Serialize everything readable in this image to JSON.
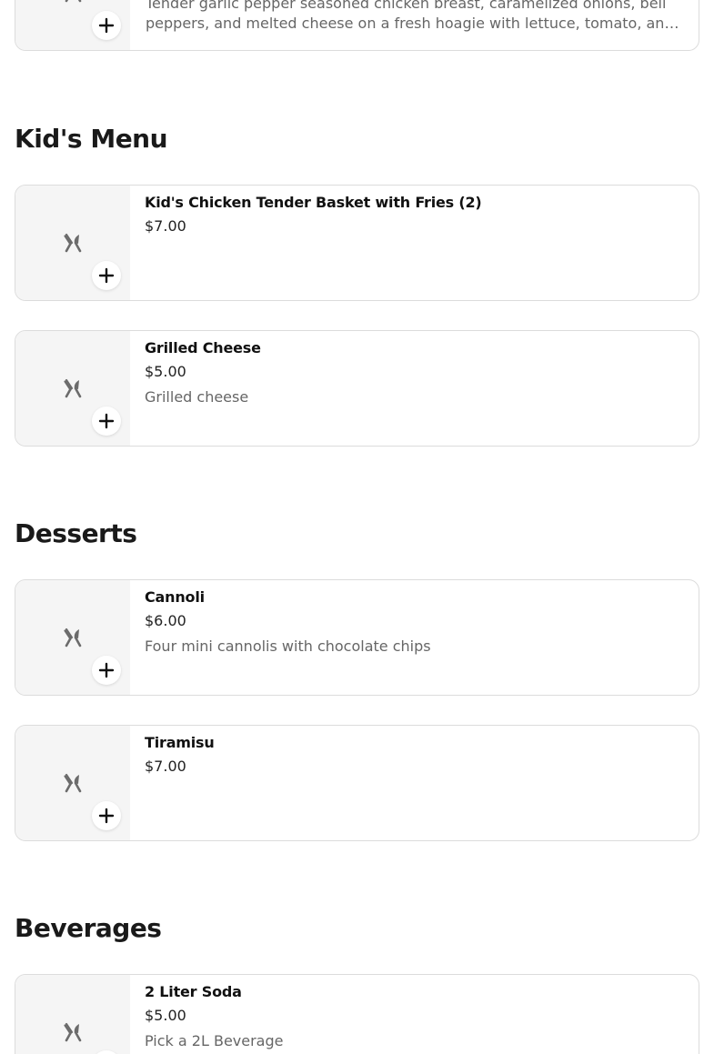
{
  "partial_item": {
    "description": "Tender garlic pepper seasoned chicken breast, caramelized onions, bell peppers, and melted cheese on a fresh hoagie with lettuce, tomato, an…"
  },
  "sections": [
    {
      "title": "Kid's Menu",
      "items": [
        {
          "name": "Kid's Chicken Tender Basket with Fries (2)",
          "price": "$7.00",
          "description": ""
        },
        {
          "name": "Grilled Cheese",
          "price": "$5.00",
          "description": "Grilled cheese"
        }
      ]
    },
    {
      "title": "Desserts",
      "items": [
        {
          "name": "Cannoli",
          "price": "$6.00",
          "description": "Four mini cannolis with chocolate chips"
        },
        {
          "name": "Tiramisu",
          "price": "$7.00",
          "description": ""
        }
      ]
    },
    {
      "title": "Beverages",
      "items": [
        {
          "name": "2 Liter Soda",
          "price": "$5.00",
          "description": "Pick a 2L Beverage"
        }
      ]
    }
  ],
  "icons": {
    "placeholder": "utensils-icon",
    "add": "plus-icon"
  },
  "colors": {
    "thumb_bg": "#f5f5f5",
    "border": "#dcdcdc",
    "description_text": "#666666"
  }
}
